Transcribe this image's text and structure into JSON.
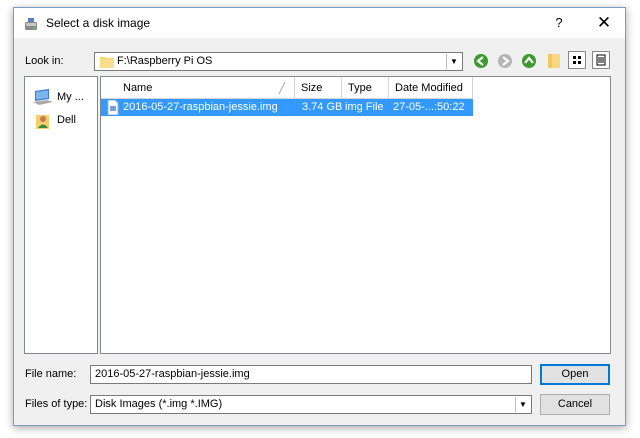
{
  "window": {
    "title": "Select a disk image",
    "help_label": "?",
    "close_label": "✕"
  },
  "lookin": {
    "label": "Look in:",
    "path": "F:\\Raspberry Pi OS"
  },
  "toolbar": {
    "icons": [
      "back-icon",
      "forward-icon",
      "up-icon",
      "new-folder-icon",
      "list-view-icon",
      "detail-view-icon"
    ]
  },
  "sidebar": {
    "items": [
      {
        "label": "My ...",
        "icon": "computer-icon"
      },
      {
        "label": "Dell",
        "icon": "user-folder-icon"
      }
    ]
  },
  "file_list": {
    "columns": [
      "Name",
      "Size",
      "Type",
      "Date Modified"
    ],
    "rows": [
      {
        "name": "2016-05-27-raspbian-jessie.img",
        "size": "3.74 GB",
        "type": "img File",
        "modified": "27-05-...:50:22"
      }
    ]
  },
  "filename": {
    "label": "File name:",
    "value": "2016-05-27-raspbian-jessie.img"
  },
  "filetype": {
    "label": "Files of type:",
    "value": "Disk Images (*.img *.IMG)"
  },
  "buttons": {
    "open": "Open",
    "cancel": "Cancel"
  },
  "colors": {
    "selection": "#3399ff",
    "accent": "#0078d7",
    "nav_green": "#3c9a2e"
  }
}
